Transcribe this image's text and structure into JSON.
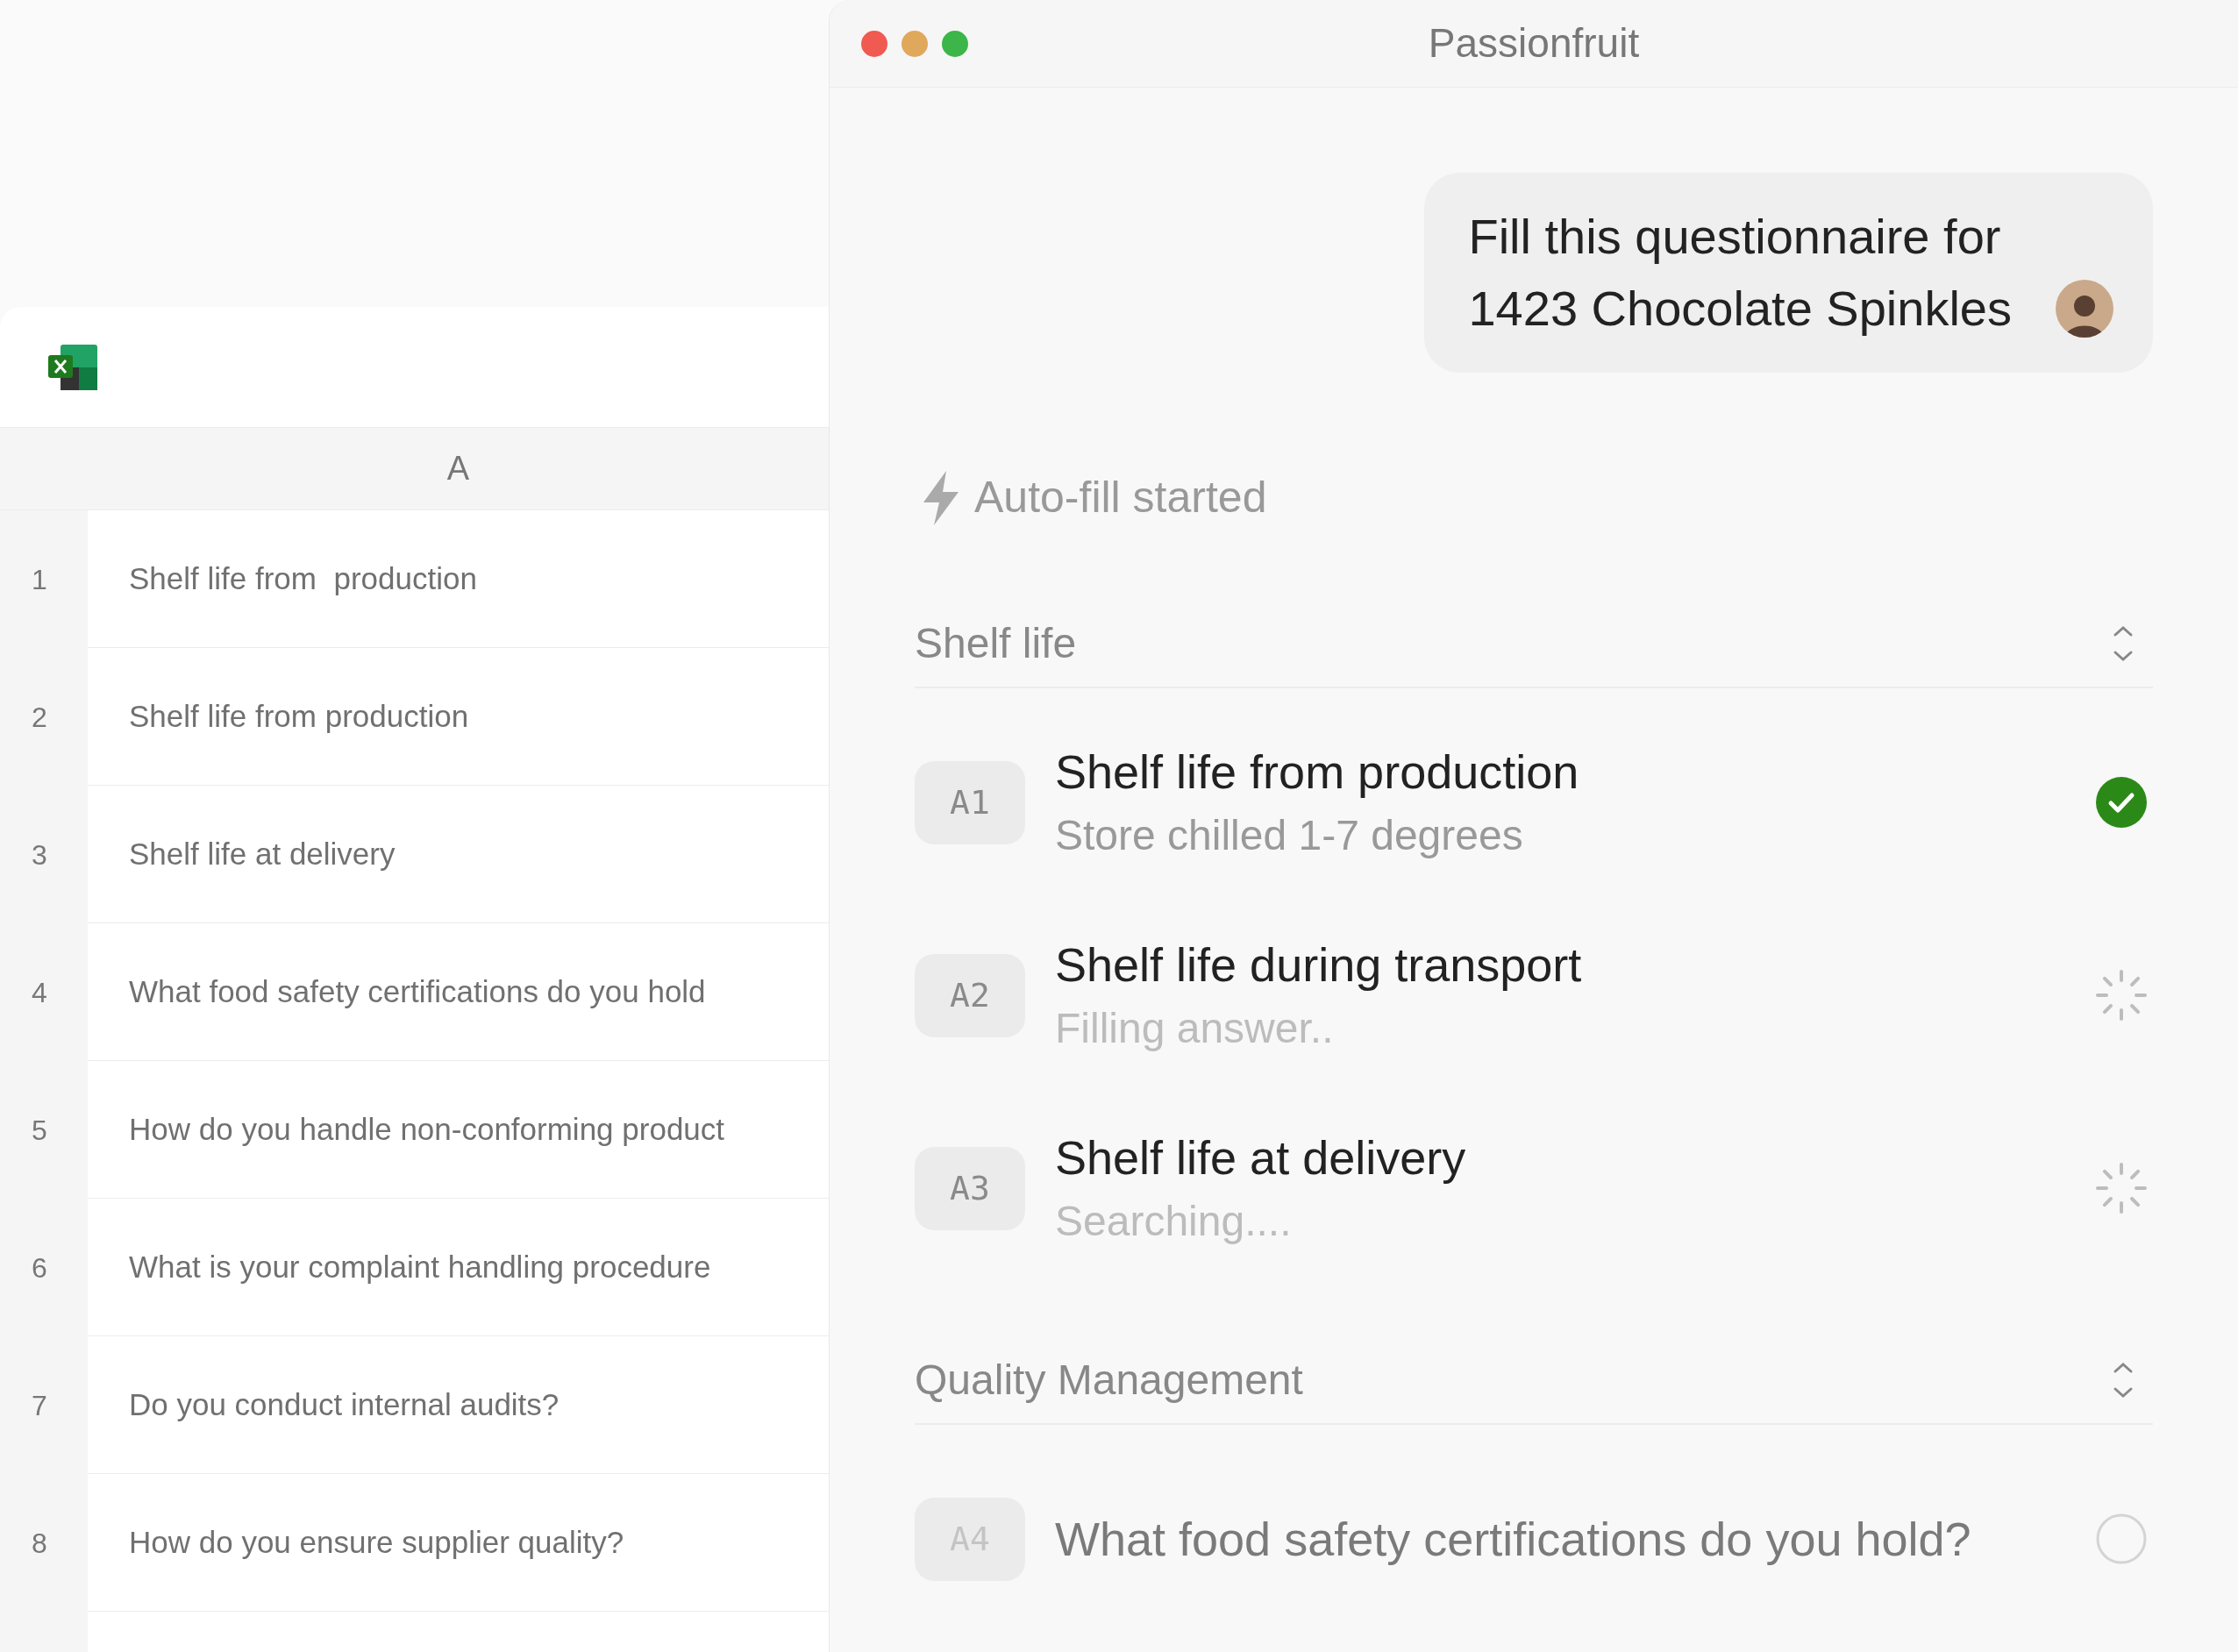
{
  "sheet": {
    "column_header": "A",
    "rows": [
      {
        "number": "1",
        "text": "Shelf life from  production"
      },
      {
        "number": "2",
        "text": "Shelf life from production"
      },
      {
        "number": "3",
        "text": "Shelf life at delivery"
      },
      {
        "number": "4",
        "text": "What food safety certifications do you hold"
      },
      {
        "number": "5",
        "text": "How do you handle non-conforming product"
      },
      {
        "number": "6",
        "text": "What is your complaint handling procedure"
      },
      {
        "number": "7",
        "text": "Do you conduct internal audits?"
      },
      {
        "number": "8",
        "text": "How do you ensure supplier quality?"
      }
    ]
  },
  "chat": {
    "title": "Passionfruit",
    "message_lines": [
      "Fill this questionnaire for",
      "1423 Chocolate Spinkles"
    ],
    "status": "Auto-fill started",
    "sections": [
      {
        "title": "Shelf life",
        "items": [
          {
            "badge": "A1",
            "title": "Shelf life from production",
            "subtitle": "Store chilled 1-7 degrees",
            "kind": "done"
          },
          {
            "badge": "A2",
            "title": "Shelf life during transport",
            "subtitle": "Filling answer..",
            "kind": "loading"
          },
          {
            "badge": "A3",
            "title": "Shelf life at delivery",
            "subtitle": "Searching....",
            "kind": "loading"
          }
        ]
      },
      {
        "title": "Quality Management",
        "items": [
          {
            "badge": "A4",
            "title": "What food safety certifications do you hold?",
            "kind": "pending"
          }
        ]
      }
    ]
  }
}
